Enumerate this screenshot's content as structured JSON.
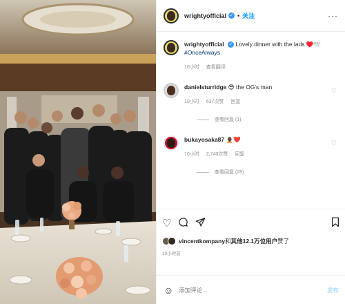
{
  "header": {
    "username": "wrightyofficial",
    "follow_label": "关注",
    "more": "···"
  },
  "caption": {
    "username": "wrightyofficial",
    "text": "Lovely dinner with the lads ♥️🕊️",
    "hashtag": "#OnceAlways",
    "time": "10小时",
    "translate": "查看翻译"
  },
  "comments": [
    {
      "username": "danielsturridge",
      "emoji": "😎",
      "text": "the OG's man",
      "time": "10小时",
      "likes": "637次赞",
      "reply": "回复",
      "view_replies": "查看回复 (1)"
    },
    {
      "username": "bukayosaka87",
      "emoji": "🧑🏿‍🦲❤️",
      "text": "",
      "time": "10小时",
      "likes": "2,740次赞",
      "reply": "回复",
      "view_replies": "查看回复 (28)"
    }
  ],
  "likes": {
    "user": "vincentkompany",
    "connector": "和",
    "others": "其他12.1万位用户",
    "suffix": "赞了"
  },
  "post_time": "10小时前",
  "add_comment": {
    "placeholder": "添加评论...",
    "post_label": "发布"
  },
  "icons": {
    "like": "heart-icon",
    "comment": "comment-icon",
    "share": "share-icon",
    "save": "bookmark-icon",
    "emoji": "emoji-icon"
  },
  "colors": {
    "link": "#0095f6",
    "verified": "#3897f0",
    "muted": "#8e8e8e"
  }
}
